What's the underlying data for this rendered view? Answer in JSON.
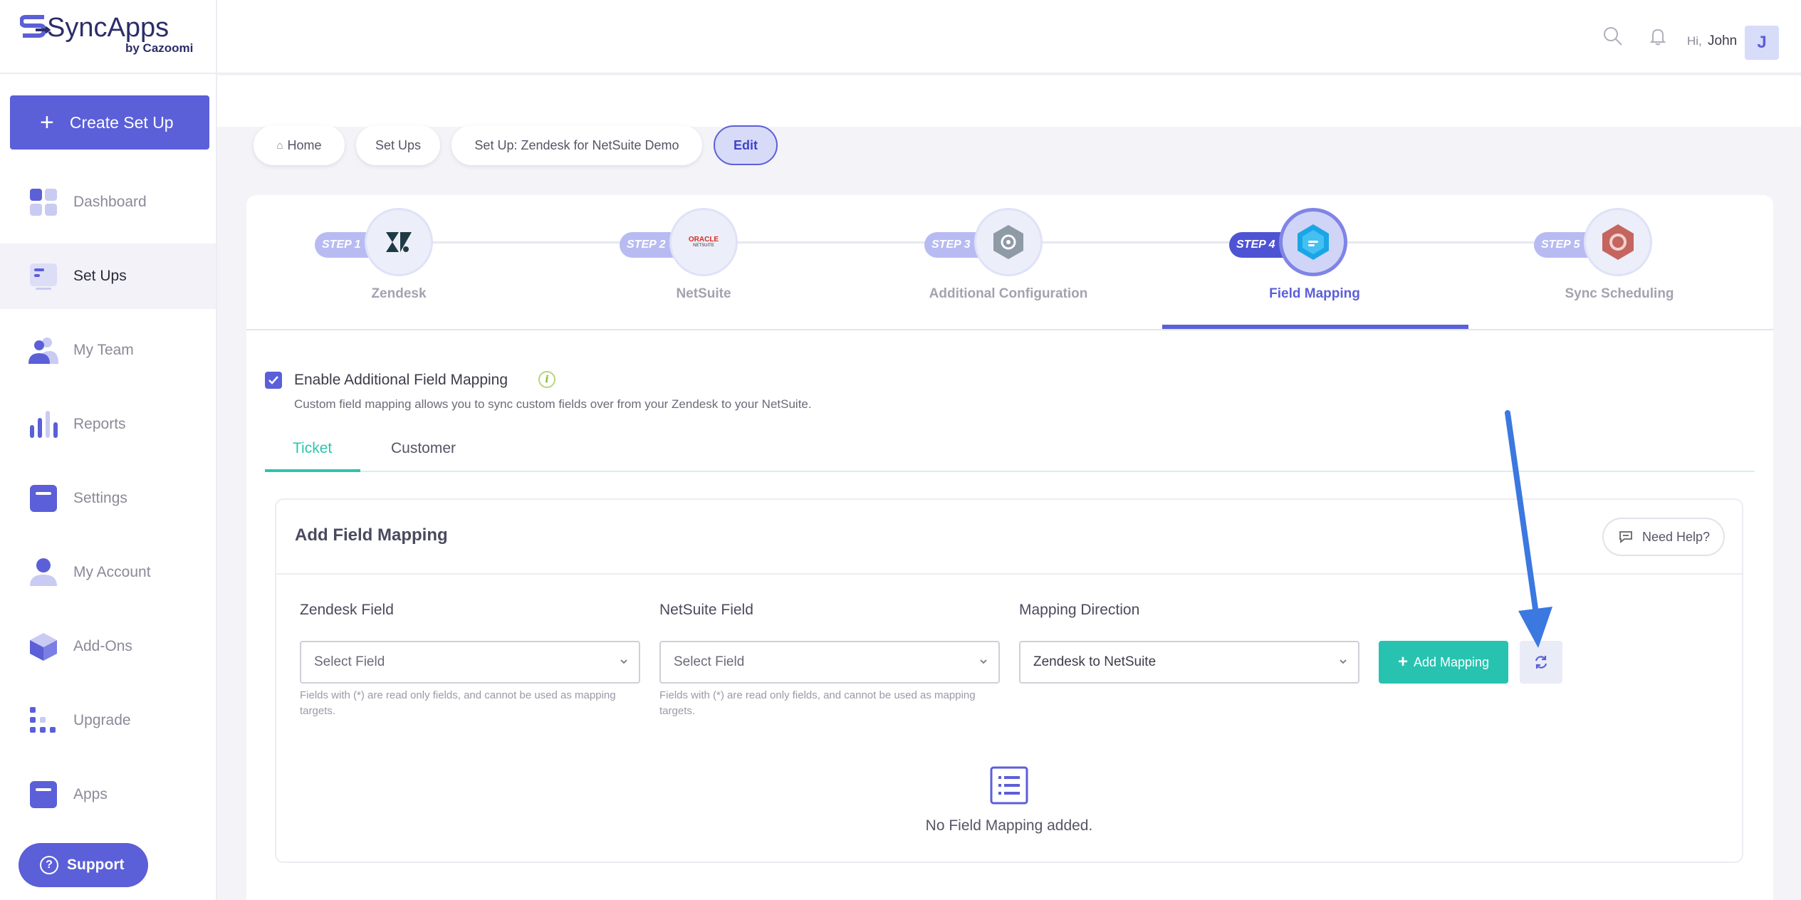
{
  "brand": {
    "name": "SyncApps",
    "sub": "by Cazoomi"
  },
  "header": {
    "greeting": "Hi,",
    "username": "John",
    "avatar_initial": "J"
  },
  "sidebar": {
    "create_label": "Create Set Up",
    "items": [
      {
        "label": "Dashboard",
        "icon": "dashboard-icon"
      },
      {
        "label": "Set Ups",
        "icon": "setups-icon",
        "active": true
      },
      {
        "label": "My Team",
        "icon": "team-icon"
      },
      {
        "label": "Reports",
        "icon": "reports-icon"
      },
      {
        "label": "Settings",
        "icon": "settings-icon"
      },
      {
        "label": "My Account",
        "icon": "account-icon"
      },
      {
        "label": "Add-Ons",
        "icon": "addons-icon"
      },
      {
        "label": "Upgrade",
        "icon": "upgrade-icon"
      },
      {
        "label": "Apps",
        "icon": "apps-icon"
      }
    ],
    "support_label": "Support"
  },
  "breadcrumb": [
    {
      "label": "Home"
    },
    {
      "label": "Set Ups"
    },
    {
      "label": "Set Up: Zendesk for NetSuite Demo"
    },
    {
      "label": "Edit",
      "active": true
    }
  ],
  "steps": [
    {
      "tag": "STEP 1",
      "label": "Zendesk"
    },
    {
      "tag": "STEP 2",
      "label": "NetSuite",
      "logo_text": "ORACLE",
      "logo_sub": "NETSUITE"
    },
    {
      "tag": "STEP 3",
      "label": "Additional Configuration"
    },
    {
      "tag": "STEP 4",
      "label": "Field Mapping",
      "active": true
    },
    {
      "tag": "STEP 5",
      "label": "Sync Scheduling"
    }
  ],
  "field_mapping": {
    "enable_label": "Enable Additional Field Mapping",
    "enabled": true,
    "info_glyph": "i",
    "description": "Custom field mapping allows you to sync custom fields over from your Zendesk to your NetSuite.",
    "tabs": [
      {
        "label": "Ticket",
        "active": true
      },
      {
        "label": "Customer"
      }
    ],
    "panel_title": "Add Field Mapping",
    "help_label": "Need Help?",
    "zendesk_label": "Zendesk Field",
    "netsuite_label": "NetSuite Field",
    "direction_label": "Mapping Direction",
    "zendesk_placeholder": "Select Field",
    "netsuite_placeholder": "Select Field",
    "direction_value": "Zendesk to NetSuite",
    "hint": "Fields with (*) are read only fields, and cannot be used as mapping targets.",
    "add_label": "Add Mapping",
    "empty_text": "No Field Mapping added."
  },
  "colors": {
    "accent": "#5b5fd8",
    "teal": "#27c3b0",
    "arrow": "#3b78e0"
  }
}
